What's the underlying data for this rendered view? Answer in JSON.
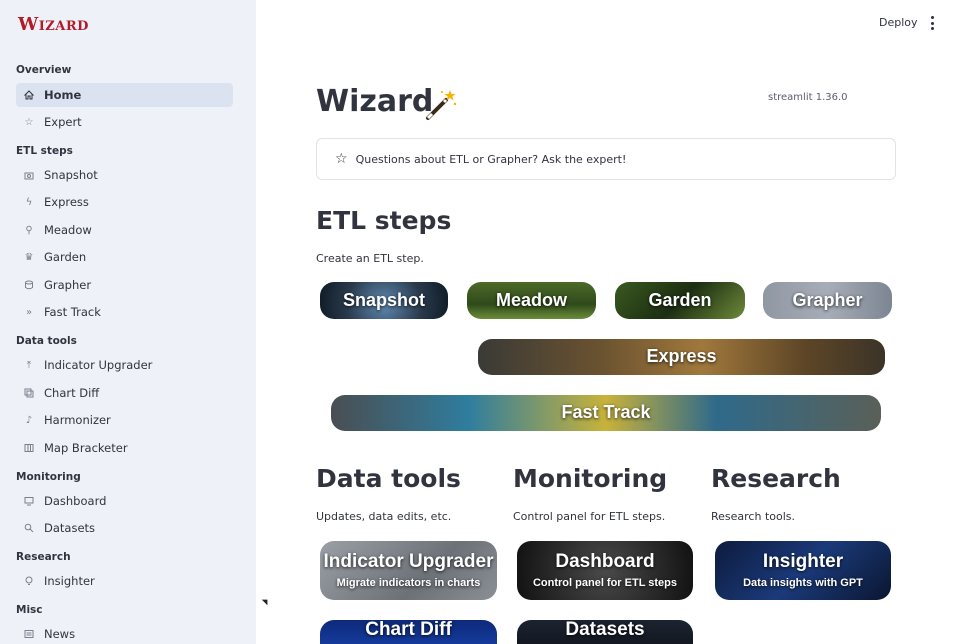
{
  "sidebar": {
    "logo": "Wizard",
    "sections": [
      {
        "label": "Overview",
        "items": [
          {
            "label": "Home",
            "icon": "home-icon",
            "active": true
          },
          {
            "label": "Expert",
            "icon": "star-icon"
          }
        ]
      },
      {
        "label": "ETL steps",
        "items": [
          {
            "label": "Snapshot",
            "icon": "camera-icon"
          },
          {
            "label": "Express",
            "icon": "bolt-icon"
          },
          {
            "label": "Meadow",
            "icon": "flower-icon"
          },
          {
            "label": "Garden",
            "icon": "trophy-icon"
          },
          {
            "label": "Grapher",
            "icon": "database-icon"
          },
          {
            "label": "Fast Track",
            "icon": "fast-forward-icon"
          }
        ]
      },
      {
        "label": "Data tools",
        "items": [
          {
            "label": "Indicator Upgrader",
            "icon": "upload-icon"
          },
          {
            "label": "Chart Diff",
            "icon": "copy-icon"
          },
          {
            "label": "Harmonizer",
            "icon": "music-note-icon"
          },
          {
            "label": "Map Bracketer",
            "icon": "map-icon"
          }
        ]
      },
      {
        "label": "Monitoring",
        "items": [
          {
            "label": "Dashboard",
            "icon": "monitor-icon"
          },
          {
            "label": "Datasets",
            "icon": "search-icon"
          }
        ]
      },
      {
        "label": "Research",
        "items": [
          {
            "label": "Insighter",
            "icon": "lightbulb-icon"
          }
        ]
      },
      {
        "label": "Misc",
        "items": [
          {
            "label": "News",
            "icon": "newspaper-icon"
          }
        ]
      }
    ]
  },
  "header": {
    "deploy_label": "Deploy"
  },
  "main": {
    "title": "Wizard",
    "version": "streamlit 1.36.0",
    "expert_prompt": "Questions about ETL or Grapher? Ask the expert!",
    "etl": {
      "heading": "ETL steps",
      "subtitle": "Create an ETL step.",
      "cards": {
        "snapshot": "Snapshot",
        "meadow": "Meadow",
        "garden": "Garden",
        "grapher": "Grapher",
        "express": "Express",
        "fast_track": "Fast Track"
      }
    },
    "data_tools": {
      "heading": "Data tools",
      "subtitle": "Updates, data edits, etc.",
      "cards": {
        "indicator_upgrader": {
          "title": "Indicator Upgrader",
          "desc": "Migrate indicators in charts"
        },
        "chart_diff": {
          "title": "Chart Diff"
        }
      }
    },
    "monitoring": {
      "heading": "Monitoring",
      "subtitle": "Control panel for ETL steps.",
      "cards": {
        "dashboard": {
          "title": "Dashboard",
          "desc": "Control panel for ETL steps"
        },
        "datasets": {
          "title": "Datasets"
        }
      }
    },
    "research": {
      "heading": "Research",
      "subtitle": "Research tools.",
      "cards": {
        "insighter": {
          "title": "Insighter",
          "desc": "Data insights with GPT"
        }
      }
    }
  },
  "colors": {
    "brand": "#b21c28",
    "sidebar_bg": "#eef2f8",
    "active_bg": "#dce3f0"
  }
}
